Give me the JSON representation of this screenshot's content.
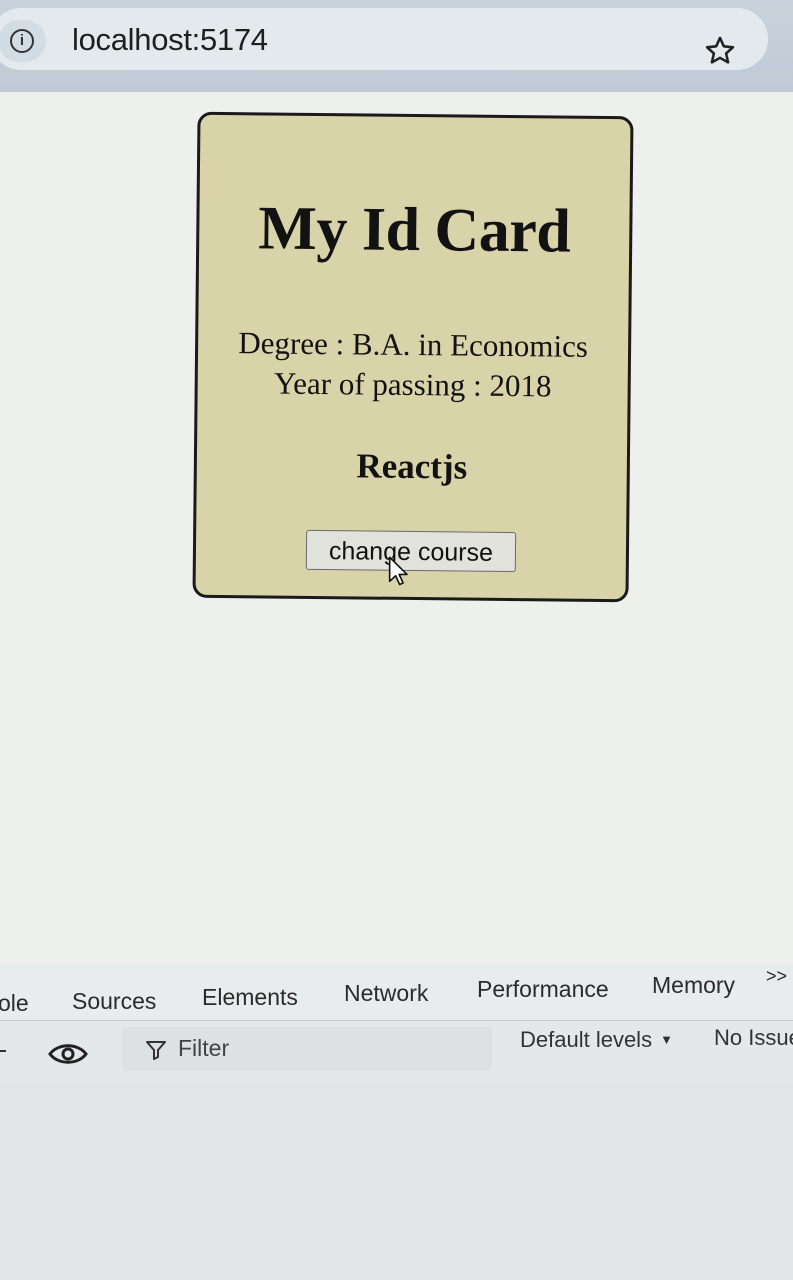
{
  "browser": {
    "url": "localhost:5174"
  },
  "card": {
    "title": "My Id Card",
    "degree": "Degree : B.A. in Economics",
    "year": "Year of passing : 2018",
    "course": "Reactjs",
    "button_label": "change course"
  },
  "devtools": {
    "tabs": [
      {
        "label": "ole"
      },
      {
        "label": "Sources"
      },
      {
        "label": "Elements"
      },
      {
        "label": "Network"
      },
      {
        "label": "Performance"
      },
      {
        "label": "Memory"
      },
      {
        "label": ">>"
      }
    ],
    "filter_placeholder": "Filter",
    "levels_label": "Default levels",
    "issues_label": "No Issue"
  },
  "colors": {
    "card_background": "#d8d3a8",
    "devtools_active_tab": "#2f5fb3"
  },
  "icons": [
    "info-icon",
    "star-icon",
    "cursor-icon",
    "eye-icon",
    "funnel-icon",
    "caret-down-icon"
  ]
}
